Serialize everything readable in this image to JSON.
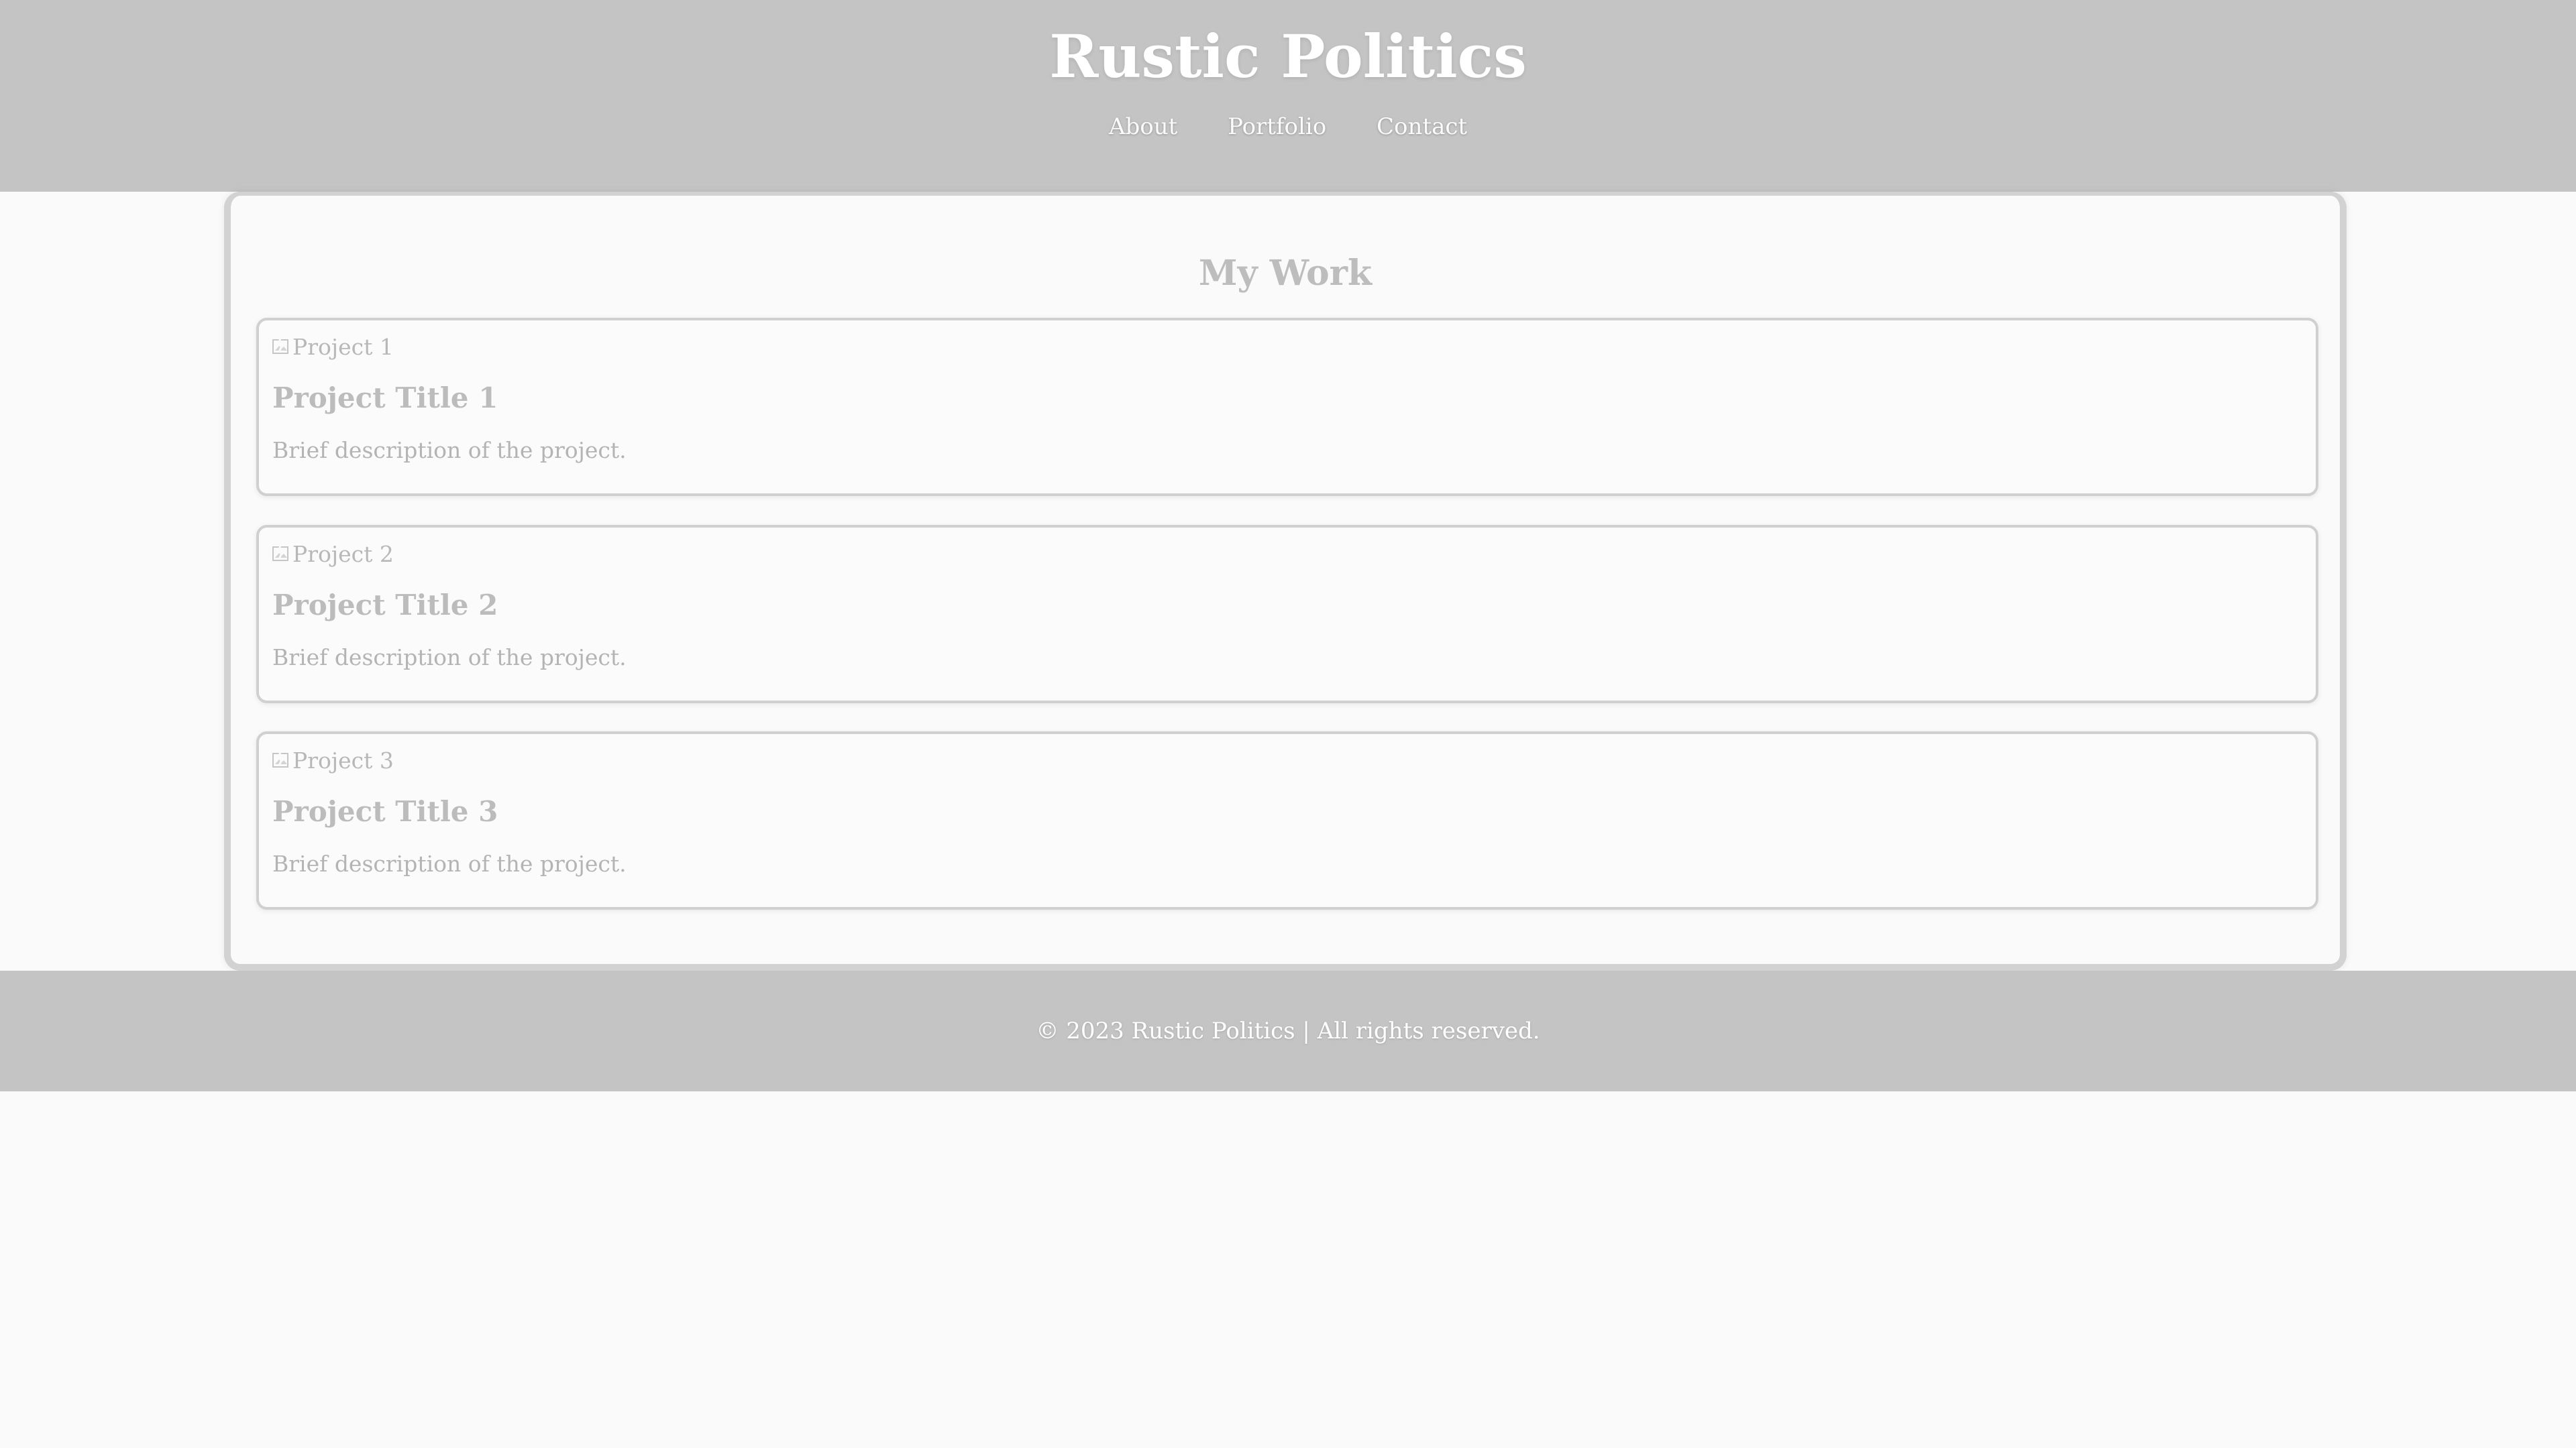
{
  "header": {
    "title": "Rustic Politics",
    "nav": [
      {
        "label": "About"
      },
      {
        "label": "Portfolio"
      },
      {
        "label": "Contact"
      }
    ]
  },
  "main": {
    "section_title": "My Work",
    "projects": [
      {
        "image_alt": "Project 1",
        "title": "Project Title 1",
        "description": "Brief description of the project."
      },
      {
        "image_alt": "Project 2",
        "title": "Project Title 2",
        "description": "Brief description of the project."
      },
      {
        "image_alt": "Project 3",
        "title": "Project Title 3",
        "description": "Brief description of the project."
      }
    ]
  },
  "footer": {
    "text": "© 2023 Rustic Politics | All rights reserved."
  },
  "icons": {
    "broken_image": "broken-image-icon"
  },
  "colors": {
    "header_bg": "#c4c4c4",
    "page_bg": "#fafafa",
    "heading_text": "#ffffff",
    "muted_text": "#b8b8b8"
  }
}
